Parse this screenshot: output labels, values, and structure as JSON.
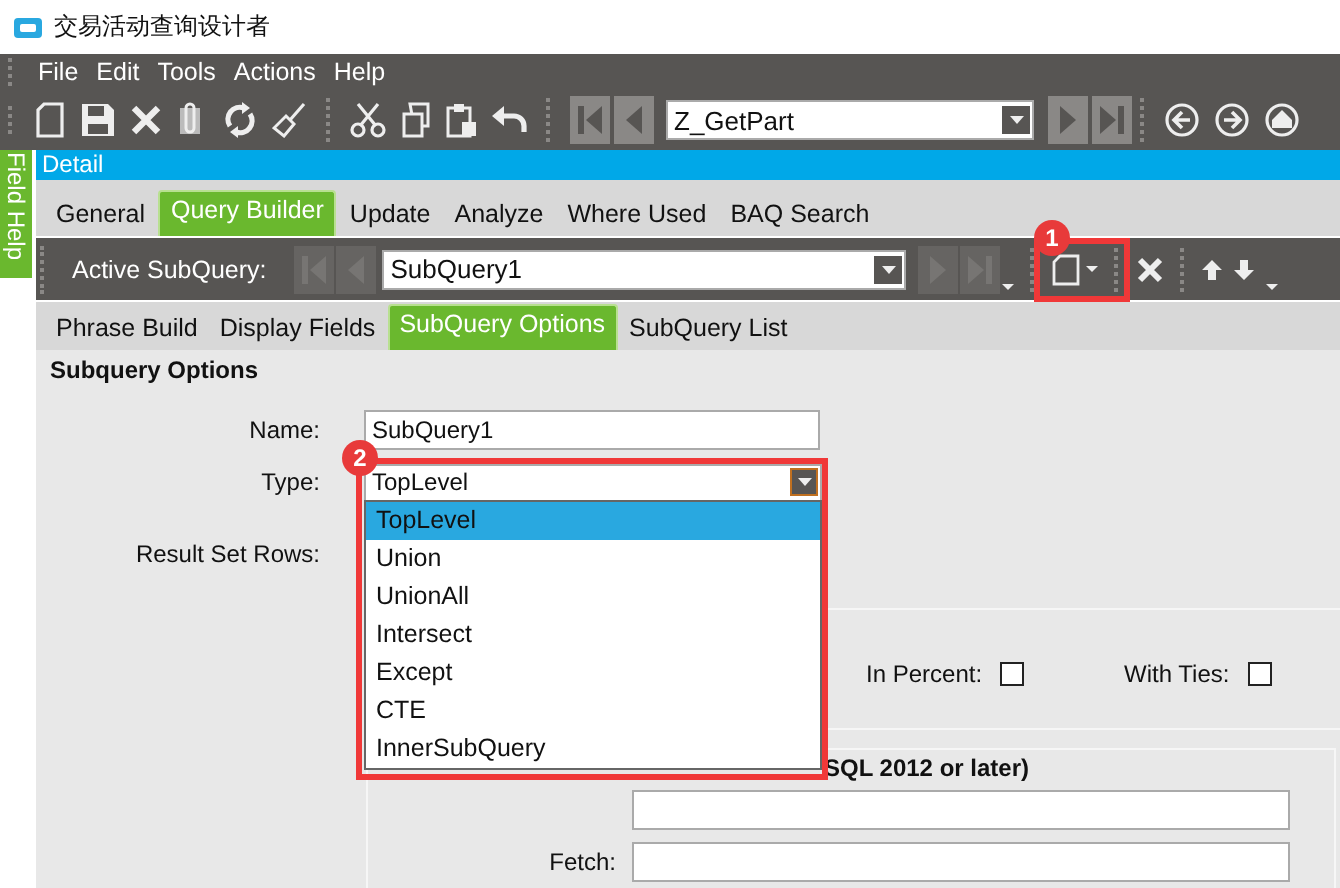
{
  "window": {
    "title": "交易活动查询设计者"
  },
  "menu": [
    {
      "label": "File"
    },
    {
      "label": "Edit"
    },
    {
      "label": "Tools"
    },
    {
      "label": "Actions"
    },
    {
      "label": "Help"
    }
  ],
  "query_selector": {
    "value": "Z_GetPart"
  },
  "field_help": {
    "label": "Field Help"
  },
  "detail_header": {
    "title": "Detail"
  },
  "tabs": [
    {
      "label": "General",
      "selected": false
    },
    {
      "label": "Query Builder",
      "selected": true
    },
    {
      "label": "Update",
      "selected": false
    },
    {
      "label": "Analyze",
      "selected": false
    },
    {
      "label": "Where Used",
      "selected": false
    },
    {
      "label": "BAQ Search",
      "selected": false
    }
  ],
  "subquery_bar": {
    "label": "Active SubQuery:",
    "value": "SubQuery1"
  },
  "subtabs": [
    {
      "label": "Phrase Build",
      "selected": false
    },
    {
      "label": "Display Fields",
      "selected": false
    },
    {
      "label": "SubQuery Options",
      "selected": true
    },
    {
      "label": "SubQuery List",
      "selected": false
    }
  ],
  "section_title": "Subquery Options",
  "form": {
    "name_label": "Name:",
    "name_value": "SubQuery1",
    "type_label": "Type:",
    "type_value": "TopLevel",
    "result_rows_label": "Result Set Rows:",
    "in_percent": {
      "label": "In Percent:",
      "checked": false
    },
    "with_ties": {
      "label": "With Ties:",
      "checked": false
    },
    "offset_group_title": "SQL 2012 or later)",
    "fetch_label": "Fetch:"
  },
  "type_dropdown": {
    "expanded": true,
    "options": [
      {
        "label": "TopLevel",
        "selected": true
      },
      {
        "label": "Union",
        "selected": false
      },
      {
        "label": "UnionAll",
        "selected": false
      },
      {
        "label": "Intersect",
        "selected": false
      },
      {
        "label": "Except",
        "selected": false
      },
      {
        "label": "CTE",
        "selected": false
      },
      {
        "label": "InnerSubQuery",
        "selected": false
      }
    ]
  },
  "annotations": [
    {
      "number": "1"
    },
    {
      "number": "2"
    }
  ]
}
